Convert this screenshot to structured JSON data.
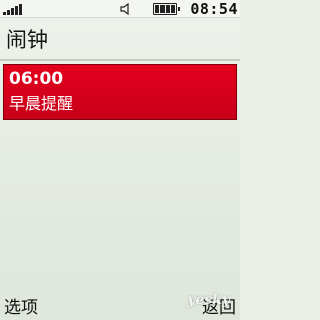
{
  "status_bar": {
    "signal_icon": "signal-strength-icon",
    "speaker_icon": "speaker-icon",
    "battery_icon": "battery-icon",
    "battery_level": 0.75,
    "time": "08:54"
  },
  "screen": {
    "title": "闹钟"
  },
  "alarms": [
    {
      "time": "06:00",
      "label": "早晨提醒",
      "selected": true
    }
  ],
  "softkeys": {
    "left": "选项",
    "right": "返回"
  },
  "colors": {
    "background": "#e9efe6",
    "selection": "#d40019",
    "text": "#111111"
  },
  "watermark": "yesky"
}
